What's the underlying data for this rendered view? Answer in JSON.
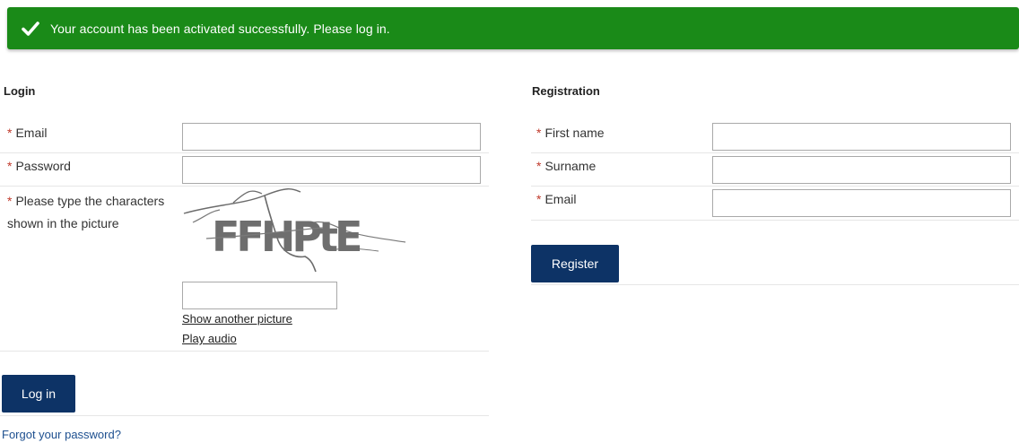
{
  "banner": {
    "message": "Your account has been activated successfully. Please log in.",
    "icon": "checkmark-icon",
    "color": "#1a8a18"
  },
  "login": {
    "title": "Login",
    "required_mark": "*",
    "email_label": "Email",
    "email_value": "",
    "password_label": "Password",
    "password_value": "",
    "captcha_label": "Please type the characters shown in the picture",
    "captcha_text": "FFHPtE",
    "captcha_value": "",
    "show_another_label": "Show another picture",
    "play_audio_label": "Play audio",
    "login_button": "Log in",
    "forgot_password": "Forgot your password?"
  },
  "registration": {
    "title": "Registration",
    "required_mark": "*",
    "first_name_label": "First name",
    "first_name_value": "",
    "surname_label": "Surname",
    "surname_value": "",
    "email_label": "Email",
    "email_value": "",
    "register_button": "Register"
  },
  "colors": {
    "button": "#0d3366",
    "required": "#c0392b",
    "link": "#1d4f8f"
  }
}
